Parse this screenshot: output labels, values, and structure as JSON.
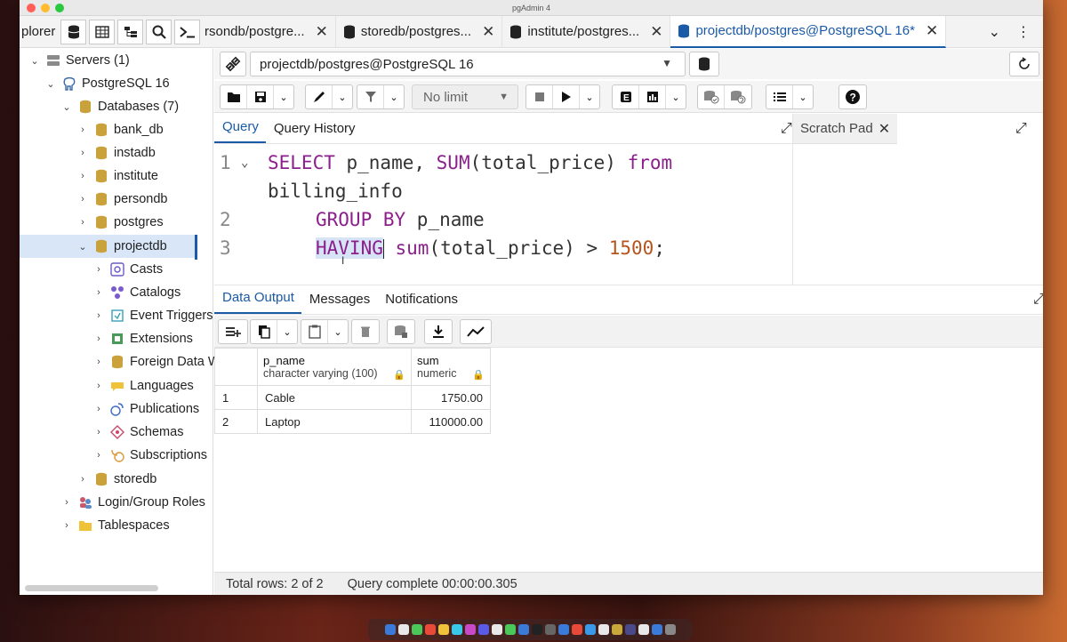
{
  "window": {
    "title": "pgAdmin 4"
  },
  "explorer": {
    "label": "plorer",
    "buttons": [
      "database-icon",
      "table-icon",
      "tree-icon",
      "search-icon",
      "terminal-icon"
    ]
  },
  "tabs": [
    {
      "label": "rsondb/postgre...",
      "active": false
    },
    {
      "label": "storedb/postgres...",
      "active": false
    },
    {
      "label": "institute/postgres...",
      "active": false
    },
    {
      "label": "projectdb/postgres@PostgreSQL 16*",
      "active": true
    }
  ],
  "tree": {
    "servers": "Servers (1)",
    "server": "PostgreSQL 16",
    "databases": "Databases (7)",
    "db_items": [
      "bank_db",
      "instadb",
      "institute",
      "persondb",
      "postgres"
    ],
    "selected_db": "projectdb",
    "schema_items": [
      "Casts",
      "Catalogs",
      "Event Triggers",
      "Extensions",
      "Foreign Data W",
      "Languages",
      "Publications",
      "Schemas",
      "Subscriptions"
    ],
    "after_db": "storedb",
    "login_roles": "Login/Group Roles",
    "tablespaces": "Tablespaces"
  },
  "connection": {
    "value": "projectdb/postgres@PostgreSQL 16"
  },
  "toolbar": {
    "limit": "No limit"
  },
  "query_tabs": {
    "query": "Query",
    "history": "Query History"
  },
  "scratch": {
    "label": "Scratch Pad"
  },
  "editor": {
    "line_numbers": [
      "1",
      "2",
      "3"
    ],
    "line1_kw1": "SELECT",
    "line1_mid": " p_name, ",
    "line1_kw2": "SUM",
    "line1_args": "(total_price) ",
    "line1_kw3": "from",
    "line1_cont": "billing_info",
    "line2_kw": "GROUP BY",
    "line2_rest": " p_name",
    "line3_kw1": "HAVING",
    "line3_kw2": "sum",
    "line3_rest": "(total_price) > ",
    "line3_num": "1500",
    "line3_end": ";"
  },
  "output_tabs": {
    "data": "Data Output",
    "messages": "Messages",
    "notifications": "Notifications"
  },
  "grid": {
    "columns": [
      {
        "name": "p_name",
        "type": "character varying (100)"
      },
      {
        "name": "sum",
        "type": "numeric"
      }
    ],
    "rows": [
      {
        "num": "1",
        "p_name": "Cable",
        "sum": "1750.00"
      },
      {
        "num": "2",
        "p_name": "Laptop",
        "sum": "110000.00"
      }
    ]
  },
  "status": {
    "rows": "Total rows: 2 of 2",
    "complete": "Query complete 00:00:00.305"
  },
  "colors": {
    "accent": "#1a5aa6",
    "keyword": "#8b1f8c",
    "number": "#b5541d",
    "selection": "#d8e6f7"
  }
}
